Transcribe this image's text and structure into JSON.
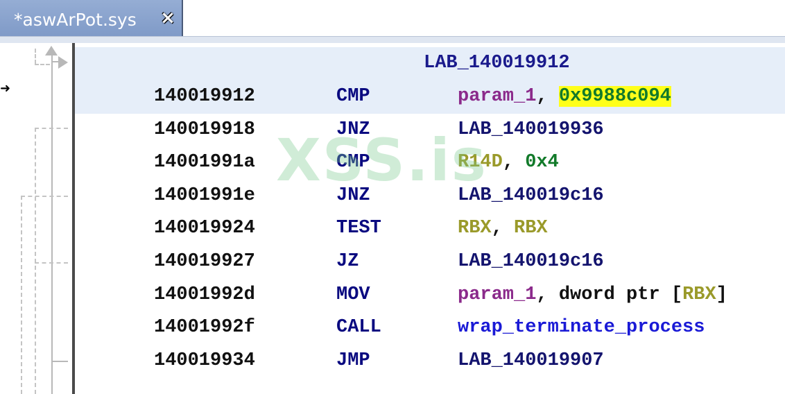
{
  "tab": {
    "title": "*aswArPot.sys",
    "close_glyph": "⨯"
  },
  "header_label": "LAB_140019912",
  "watermark": "XSS.is",
  "rows": [
    {
      "addr": "140019912",
      "mnemonic": "CMP",
      "ops": [
        {
          "t": "param_1",
          "k": "param"
        },
        {
          "t": ", ",
          "k": "punct"
        },
        {
          "t": "0x9988c094",
          "k": "hl"
        }
      ]
    },
    {
      "addr": "140019918",
      "mnemonic": "JNZ",
      "ops": [
        {
          "t": "LAB_140019936",
          "k": "label"
        }
      ]
    },
    {
      "addr": "14001991a",
      "mnemonic": "CMP",
      "ops": [
        {
          "t": "R14D",
          "k": "reg"
        },
        {
          "t": ", ",
          "k": "punct"
        },
        {
          "t": "0x4",
          "k": "num"
        }
      ]
    },
    {
      "addr": "14001991e",
      "mnemonic": "JNZ",
      "ops": [
        {
          "t": "LAB_140019c16",
          "k": "label"
        }
      ]
    },
    {
      "addr": "140019924",
      "mnemonic": "TEST",
      "ops": [
        {
          "t": "RBX",
          "k": "reg"
        },
        {
          "t": ", ",
          "k": "punct"
        },
        {
          "t": "RBX",
          "k": "reg"
        }
      ]
    },
    {
      "addr": "140019927",
      "mnemonic": "JZ",
      "ops": [
        {
          "t": "LAB_140019c16",
          "k": "label"
        }
      ]
    },
    {
      "addr": "14001992d",
      "mnemonic": "MOV",
      "ops": [
        {
          "t": "param_1",
          "k": "param"
        },
        {
          "t": ", dword ptr [",
          "k": "punct"
        },
        {
          "t": "RBX",
          "k": "reg"
        },
        {
          "t": "]",
          "k": "punct"
        }
      ]
    },
    {
      "addr": "14001992f",
      "mnemonic": "CALL",
      "ops": [
        {
          "t": "wrap_terminate_process",
          "k": "func"
        }
      ]
    },
    {
      "addr": "140019934",
      "mnemonic": "JMP",
      "ops": [
        {
          "t": "LAB_140019907",
          "k": "label"
        }
      ]
    }
  ],
  "colors": {
    "tab_bg": "#7d98c6",
    "highlight_band": "#e6eef9",
    "scalar_highlight": "#ffff1a",
    "param": "#8b2a8b",
    "register": "#9a9a2a",
    "number": "#127a2a",
    "function": "#1a1ad6",
    "label": "#14146e"
  },
  "icons": [
    "close-icon",
    "flow-arrow-up-icon",
    "flow-arrow-right-icon",
    "cursor-arrow-icon"
  ]
}
